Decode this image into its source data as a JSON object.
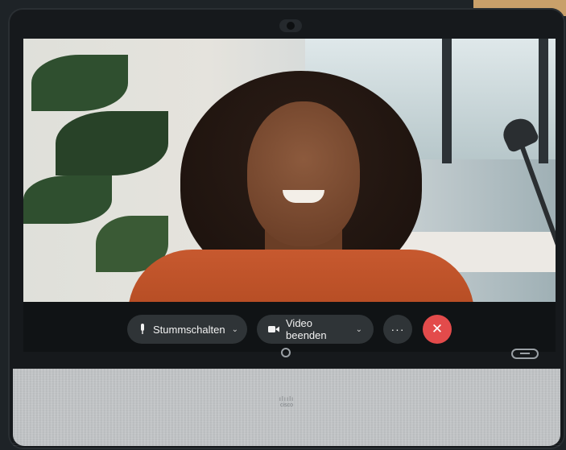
{
  "controls": {
    "mute_label": "Stummschalten",
    "video_label": "Video beenden",
    "more_label": "···",
    "end_label": "✕"
  },
  "device": {
    "brand": "cisco"
  },
  "colors": {
    "end_call": "#e34b4b",
    "pill_bg": "#2f3437"
  },
  "icons": {
    "mute": "microphone-icon",
    "video": "camera-icon",
    "chevron": "chevron-down-icon",
    "end": "close-icon"
  }
}
